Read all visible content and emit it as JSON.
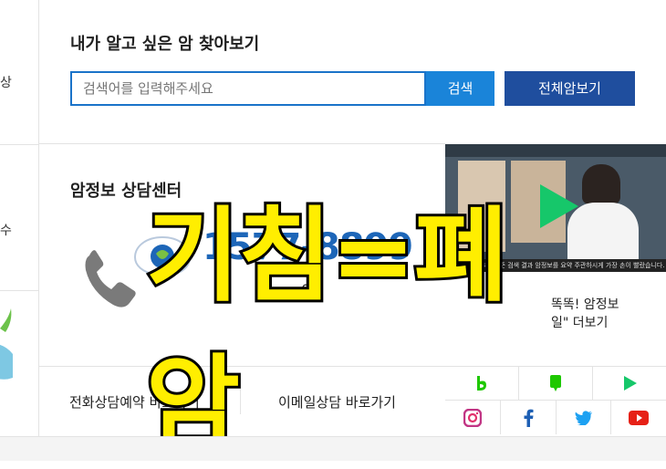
{
  "left_strip": {
    "text_top": "상",
    "text_mid": "수"
  },
  "search_section": {
    "title": "내가 알고 싶은 암 찾아보기",
    "placeholder": "검색어를 입력해주세요",
    "search_button": "검색",
    "all_button": "전체암보기"
  },
  "counsel": {
    "title": "암정보 상담센터",
    "phone": "1577-8899",
    "hours_partial": "00"
  },
  "video": {
    "caption": "1회에 한 3~4분 기준 검색 결과 암정보를 요약 주관하시게 가장 손이 빨랐습니다."
  },
  "side_promo": {
    "line1": "똑똑! 암정보",
    "line2": "일\" 더보기"
  },
  "bottom_links": {
    "phone_reserve": "전화상담예약 바로가기",
    "email": "이메일상담 바로가기"
  },
  "overlay_text": "기침=폐암",
  "colors": {
    "search_blue": "#1a84d9",
    "navy": "#1f4e9e",
    "phone_blue": "#1d66b8",
    "overlay_yellow": "#ffee00"
  },
  "sns_icons": [
    "band-icon",
    "blog-icon",
    "play-icon",
    "instagram-icon",
    "facebook-icon",
    "twitter-icon",
    "youtube-icon"
  ]
}
